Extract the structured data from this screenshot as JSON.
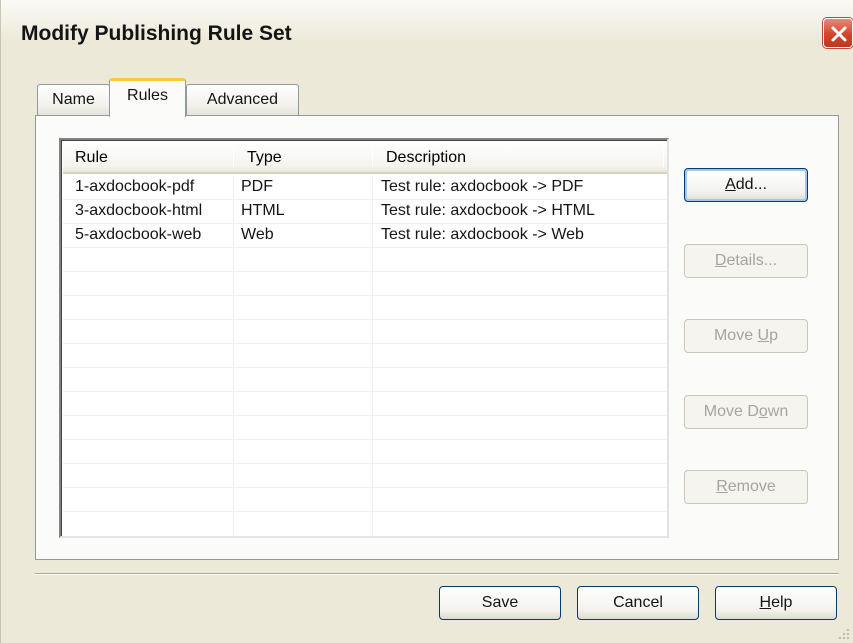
{
  "window": {
    "title": "Modify Publishing Rule Set",
    "close_icon": "close-icon",
    "accent_color": "#d2452a"
  },
  "tabs": [
    {
      "label": "Name",
      "active": false
    },
    {
      "label": "Rules",
      "active": true
    },
    {
      "label": "Advanced",
      "active": false
    }
  ],
  "rules_table": {
    "columns": [
      "Rule",
      "Type",
      "Description"
    ],
    "rows": [
      [
        "1-axdocbook-pdf",
        "PDF",
        "Test rule:  axdocbook -> PDF"
      ],
      [
        "3-axdocbook-html",
        "HTML",
        "Test rule:  axdocbook -> HTML"
      ],
      [
        "5-axdocbook-web",
        "Web",
        "Test rule:  axdocbook -> Web"
      ]
    ]
  },
  "side_buttons": {
    "add": {
      "label_pre": "",
      "mnemonic": "A",
      "label_post": "dd...",
      "enabled": true
    },
    "details": {
      "label_pre": "",
      "mnemonic": "D",
      "label_post": "etails...",
      "enabled": false
    },
    "move_up": {
      "label_pre": "Move ",
      "mnemonic": "U",
      "label_post": "p",
      "enabled": false
    },
    "move_down": {
      "label_pre": "Move D",
      "mnemonic": "o",
      "label_post": "wn",
      "enabled": false
    },
    "remove": {
      "label_pre": "",
      "mnemonic": "R",
      "label_post": "emove",
      "enabled": false
    }
  },
  "footer_buttons": {
    "save": {
      "label": "Save"
    },
    "cancel": {
      "label": "Cancel"
    },
    "help": {
      "label_pre": "",
      "mnemonic": "H",
      "label_post": "elp"
    }
  }
}
